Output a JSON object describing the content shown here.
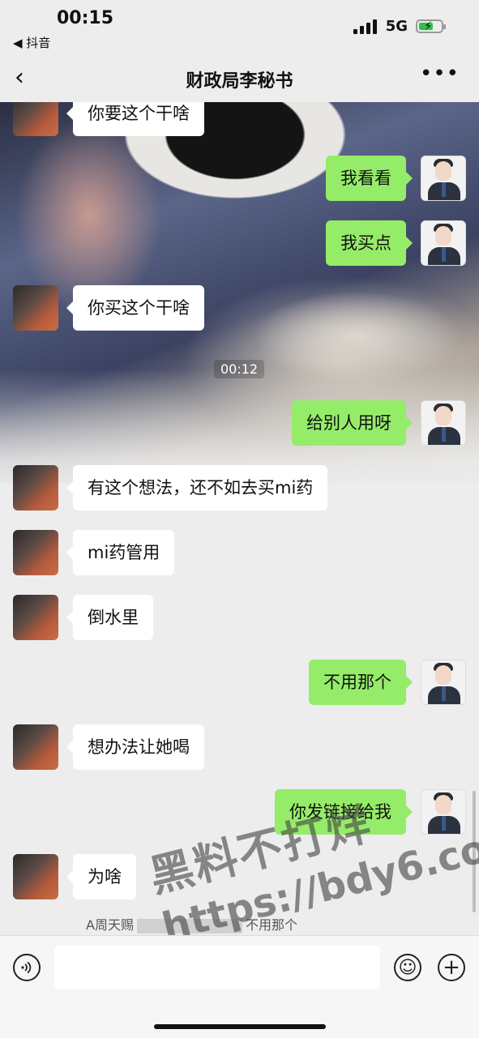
{
  "status_bar": {
    "time": "00:15",
    "back_app": "◀ 抖音",
    "network": "5G",
    "battery_charging": true
  },
  "nav": {
    "back_icon": "chevron-left-icon",
    "title": "财政局李秘书",
    "more_icon": "more-dots-icon"
  },
  "chat": {
    "timestamp": "00:12",
    "messages": [
      {
        "side": "left",
        "text": "你要这个干啥"
      },
      {
        "side": "right",
        "text": "我看看"
      },
      {
        "side": "right",
        "text": "我买点"
      },
      {
        "side": "left",
        "text": "你买这个干啥"
      },
      {
        "side": "right",
        "text": "给别人用呀"
      },
      {
        "side": "left",
        "text": "有这个想法，还不如去买mi药"
      },
      {
        "side": "left",
        "text": "mi药管用"
      },
      {
        "side": "left",
        "text": "倒水里"
      },
      {
        "side": "right",
        "text": "不用那个"
      },
      {
        "side": "left",
        "text": "想办法让她喝"
      },
      {
        "side": "right",
        "text": "你发链接给我"
      },
      {
        "side": "left",
        "text": "为啥"
      }
    ],
    "quote_prefix": "A周天赐",
    "quote_suffix": "不用那个"
  },
  "watermark": {
    "line1": "黑料不打烊",
    "line2": "https://bdy6.co"
  },
  "input_bar": {
    "voice_icon": "voice-icon",
    "emoji_icon": "emoji-icon",
    "plus_icon": "plus-icon"
  },
  "colors": {
    "sent_bubble": "#95ec69",
    "received_bubble": "#ffffff",
    "background": "#ededed"
  }
}
